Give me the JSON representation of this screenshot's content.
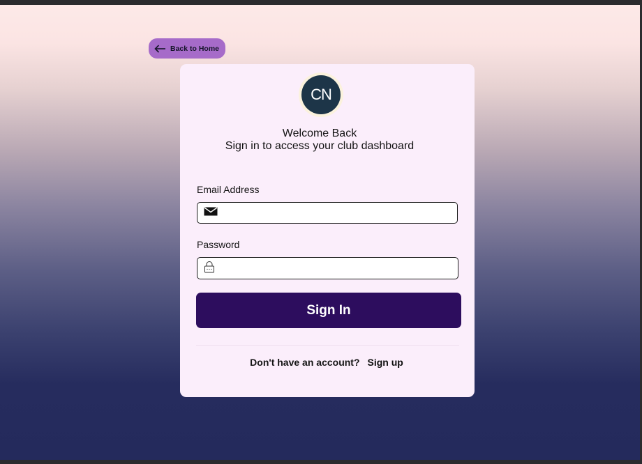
{
  "back_button": {
    "label": "Back to Home",
    "icon": "arrow-left-icon"
  },
  "card": {
    "logo_text": "CN",
    "title": "Welcome Back",
    "subtitle": "Sign in to access your club dashboard"
  },
  "form": {
    "email": {
      "label": "Email Address",
      "value": "",
      "icon": "envelope-icon"
    },
    "password": {
      "label": "Password",
      "value": "",
      "icon": "lock-icon"
    },
    "submit_label": "Sign In"
  },
  "footer": {
    "prompt": "Don't have an account?",
    "link_label": "Sign up"
  },
  "colors": {
    "back_button_bg": "#a66bc9",
    "card_bg": "#fbeefb",
    "primary_button": "#2d0d5e",
    "logo_bg": "#1d3548",
    "page_bottom": "#242a5c"
  }
}
